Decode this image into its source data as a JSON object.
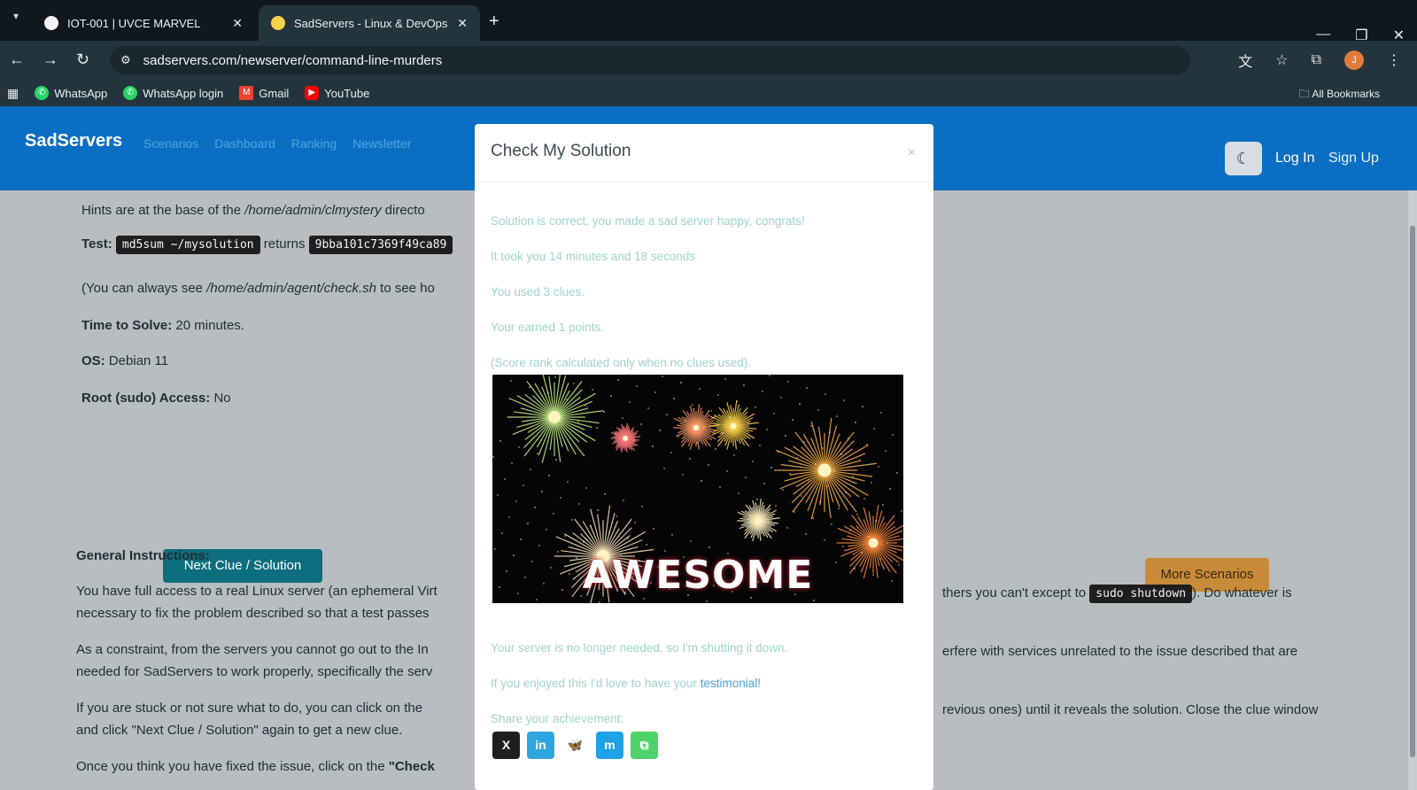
{
  "browser": {
    "tabs": [
      {
        "title": "IOT-001 | UVCE MARVEL",
        "favicon_color": "#f2f2f2"
      },
      {
        "title": "SadServers - Linux & DevOps T",
        "favicon_color": "#f5d34a"
      }
    ],
    "new_tab": "+",
    "url": "sadservers.com/newserver/command-line-murders",
    "bookmarks": [
      {
        "label": "WhatsApp",
        "icon": "whatsapp-icon",
        "color": "#25d366"
      },
      {
        "label": "WhatsApp login",
        "icon": "whatsapp-icon",
        "color": "#25d366"
      },
      {
        "label": "Gmail",
        "icon": "gmail-icon",
        "color": "#ea4335"
      },
      {
        "label": "YouTube",
        "icon": "youtube-icon",
        "color": "#ff0000"
      }
    ],
    "all_bookmarks": "All Bookmarks",
    "profile_initial": "J"
  },
  "site": {
    "brand": "SadServers",
    "nav": [
      "Scenarios",
      "Dashboard",
      "Ranking",
      "Newsletter"
    ],
    "login": "Log In",
    "signup": "Sign Up"
  },
  "content": {
    "hints_prefix": "Hints are at the base of the ",
    "hints_path": "/home/admin/clmystery",
    "hints_suffix": " directo",
    "test_label": "Test:",
    "test_cmd": "md5sum ~/mysolution",
    "test_returns": "returns",
    "test_hash": "9bba101c7369f49ca89",
    "check_prefix": "(You can always see ",
    "check_path": "/home/admin/agent/check.sh",
    "check_suffix": " to see ho",
    "time_label": "Time to Solve:",
    "time_value": "20 minutes.",
    "os_label": "OS:",
    "os_value": "Debian 11",
    "root_label": "Root (sudo) Access:",
    "root_value": "No",
    "next_clue": "Next Clue / Solution",
    "more_scenarios": "More Scenarios",
    "general_heading": "General Instructions:",
    "p1_left_1": "You have full access to a real Linux server (an ephemeral Virt",
    "p1_left_2": "necessary to fix the problem described so that a test passes",
    "p1_right_1": "thers you can't except to",
    "p1_code": "sudo shutdown",
    "p1_right_1b": "). Do whatever is",
    "p2_left_1": "As a constraint, from the servers you cannot go out to the In",
    "p2_left_2": "needed for SadServers to work properly, specifically the serv",
    "p2_right_1": "erfere with services unrelated to the issue described that are",
    "p3_left_1": "If you are stuck or not sure what to do, you can click on the",
    "p3_left_2": "and click \"Next Clue / Solution\" again to get a new clue.",
    "p3_right_1": "revious ones) until it reveals the solution. Close the clue window",
    "p4_left_1": "Once you think you have fixed the issue, click on the ",
    "p4_left_bold": "\"Check"
  },
  "modal": {
    "title": "Check My Solution",
    "close": "×",
    "line_correct": "Solution is correct, you made a sad server happy, congrats!",
    "line_time": "It took you 14 minutes and 18 seconds",
    "line_clues": "You used 3 clues.",
    "line_points": "Your earned 1 points.",
    "line_rank": "(Score rank calculated only when no clues used).",
    "image_caption": "AWESOME",
    "line_shutdown": "Your server is no longer needed, so I'm shutting it down.",
    "line_testimonial_prefix": "If you enjoyed this I'd love to have your ",
    "line_testimonial_link": "testimonial!",
    "line_share": "Share your achievement:",
    "share_buttons": [
      {
        "name": "x-icon",
        "glyph": "X",
        "color": "#1f1f1f"
      },
      {
        "name": "linkedin-icon",
        "glyph": "in",
        "color": "#2fa5e0"
      },
      {
        "name": "bluesky-icon",
        "glyph": "🦋",
        "color": "#ffffff"
      },
      {
        "name": "mastodon-icon",
        "glyph": "m",
        "color": "#1fa1e5"
      },
      {
        "name": "copy-icon",
        "glyph": "⧉",
        "color": "#4ed36b"
      }
    ]
  }
}
